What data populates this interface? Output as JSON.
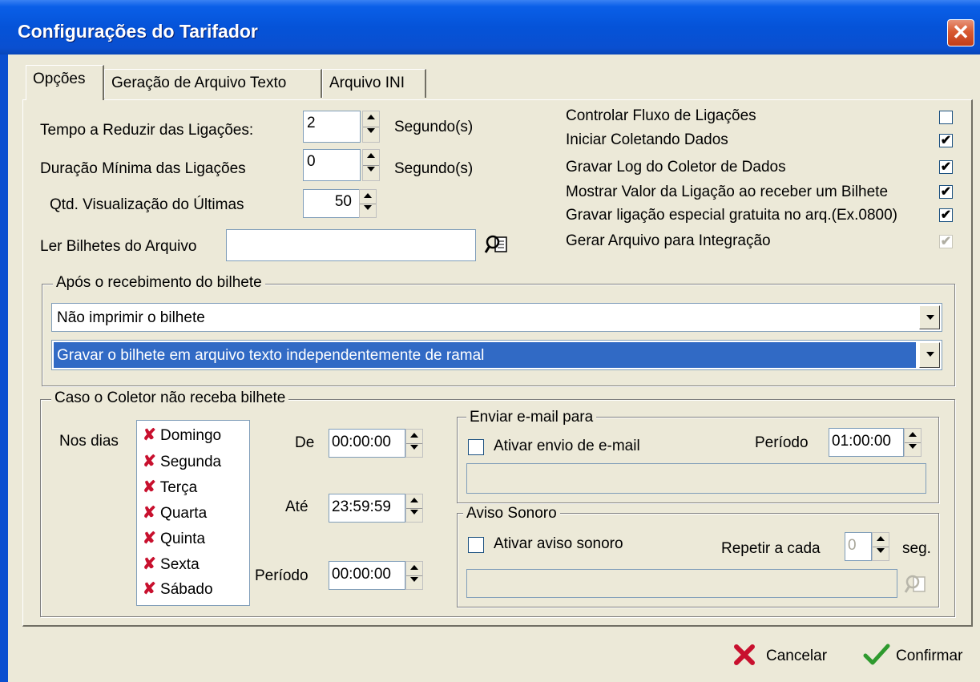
{
  "window": {
    "title": "Configurações do Tarifador",
    "close_symbol": "✕"
  },
  "tabs": [
    "Opções",
    "Geração de Arquivo Texto",
    "Arquivo INI"
  ],
  "options": {
    "tempo_reduzir": {
      "label": "Tempo a Reduzir das Ligações:",
      "value": "2",
      "unit": "Segundo(s)"
    },
    "duracao_minima": {
      "label": "Duração Mínima das Ligações",
      "value": "0",
      "unit": "Segundo(s)"
    },
    "qtd_visualizacao": {
      "label": "Qtd. Visualização do Últimas",
      "value": "50"
    },
    "ler_bilhetes": {
      "label": "Ler Bilhetes do Arquivo",
      "value": ""
    }
  },
  "checkboxes": [
    {
      "label": "Controlar Fluxo de Ligações",
      "mark": ""
    },
    {
      "label": "Iniciar Coletando Dados",
      "mark": "✔"
    },
    {
      "label": "Gravar Log do Coletor de Dados",
      "mark": "✔"
    },
    {
      "label": "Mostrar Valor da Ligação ao receber um Bilhete",
      "mark": "✔"
    },
    {
      "label": "Gravar ligação especial gratuita no arq.(Ex.0800)",
      "mark": "✔"
    },
    {
      "label": "Gerar Arquivo para Integração",
      "mark": "✔"
    }
  ],
  "apos_recebimento": {
    "title": "Após o recebimento do bilhete",
    "combo1": "Não imprimir o bilhete",
    "combo2": "Gravar o bilhete em arquivo texto independentemente de ramal"
  },
  "caso_coletor": {
    "title": "Caso o Coletor não receba bilhete",
    "nos_dias_label": "Nos dias",
    "x_symbol": "✘",
    "dias": [
      "Domingo",
      "Segunda",
      "Terça",
      "Quarta",
      "Quinta",
      "Sexta",
      "Sábado"
    ],
    "de": {
      "label": "De",
      "value": "00:00:00"
    },
    "ate": {
      "label": "Até",
      "value": "23:59:59"
    },
    "periodo": {
      "label": "Período",
      "value": "00:00:00"
    }
  },
  "email": {
    "title": "Enviar e-mail para",
    "checkbox_label": "Ativar envio de e-mail",
    "periodo_label": "Período",
    "periodo_value": "01:00:00",
    "address": ""
  },
  "aviso": {
    "title": "Aviso Sonoro",
    "checkbox_label": "Ativar aviso sonoro",
    "repetir_label": "Repetir a cada",
    "repetir_value": "0",
    "unit": "seg.",
    "file": ""
  },
  "footer": {
    "cancel_label": "Cancelar",
    "confirm_label": "Confirmar"
  },
  "colors": {
    "titlebar": "#0553D8",
    "face": "#ECE9D8",
    "selection": "#316AC5",
    "x_red": "#C8102E",
    "check_green": "#2E9A2E"
  }
}
